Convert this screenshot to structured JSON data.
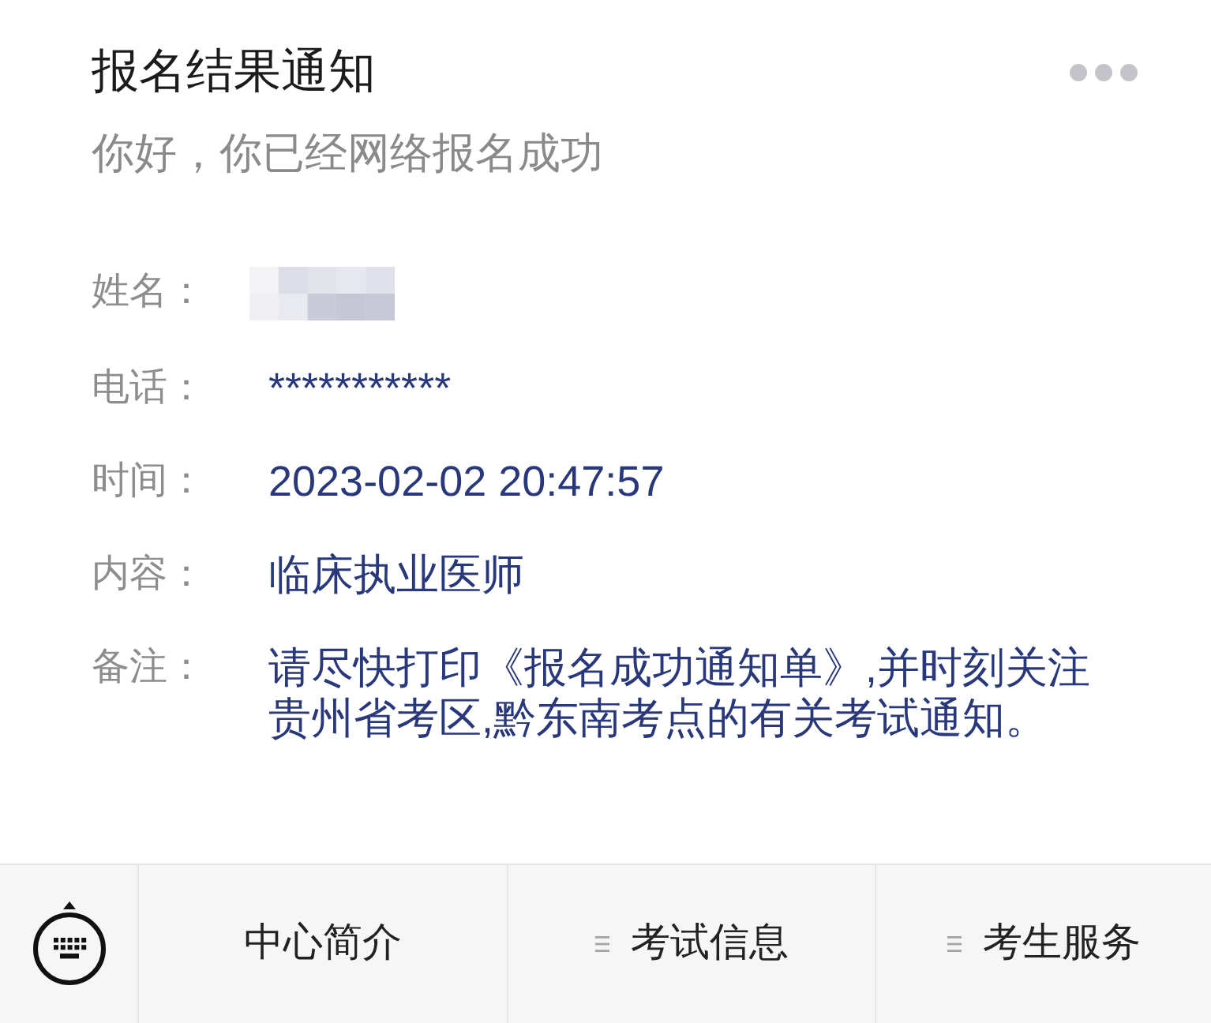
{
  "header": {
    "title": "报名结果通知",
    "subtitle": "你好，你已经网络报名成功"
  },
  "fields": [
    {
      "label": "姓名：",
      "kind": "redacted"
    },
    {
      "label": "电话：",
      "kind": "text",
      "value": "***********"
    },
    {
      "label": "时间：",
      "kind": "text",
      "value": "2023-02-02 20:47:57"
    },
    {
      "label": "内容：",
      "kind": "text",
      "value": "临床执业医师"
    },
    {
      "label": "备注：",
      "kind": "text",
      "value": "请尽快打印《报名成功通知单》,并时刻关注贵州省考区,黔东南考点的有关考试通知。"
    }
  ],
  "menu": [
    {
      "label": "中心简介",
      "submenu": false
    },
    {
      "label": "考试信息",
      "submenu": true
    },
    {
      "label": "考生服务",
      "submenu": true
    }
  ]
}
